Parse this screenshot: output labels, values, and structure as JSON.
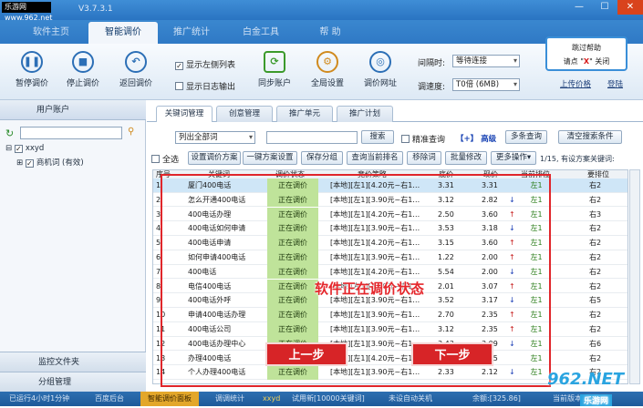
{
  "window": {
    "watermark": "乐游网 www.962.net",
    "title": "V3.7.3.1",
    "close_glyph": "✕",
    "min_glyph": "—",
    "max_glyph": "☐"
  },
  "main_tabs": [
    "软件主页",
    "智能调价",
    "推广统计",
    "白金工具",
    "帮 助"
  ],
  "toolbar": {
    "buttons": [
      {
        "label": "暂停调价",
        "icon": "pause-icon"
      },
      {
        "label": "停止调价",
        "icon": "stop-icon"
      },
      {
        "label": "返回调价",
        "icon": "return-icon"
      },
      {
        "label": "同步账户",
        "icon": "sync-icon"
      },
      {
        "label": "全局设置",
        "icon": "settings-icon"
      },
      {
        "label": "调价网址",
        "icon": "globe-icon"
      }
    ],
    "checkbox_left_list": "显示左侧列表",
    "checkbox_log": "显示日志输出",
    "interval_label": "间隔时:",
    "interval_value": "等待连接",
    "speed_label": "调速度:",
    "speed_value": "T0倍 (6MB)",
    "upload_link": "上传价格",
    "account_link": "登陆",
    "help_line1": "跳过帮助",
    "help_line2_pre": "请点 \"",
    "help_line2_x": "X",
    "help_line2_post": "\" 关闭"
  },
  "left": {
    "header": "用户账户",
    "tree_root": "xxyd",
    "tree_child": "商机词 (有效)",
    "footer1": "监控文件夹",
    "footer2": "分组管理"
  },
  "subtabs": [
    "关键词管理",
    "创意管理",
    "推广单元",
    "推广计划"
  ],
  "filter": {
    "scope": "列出全部词",
    "search_btn": "搜索",
    "exact_label": "精准查询",
    "advanced": "【+】 高级",
    "multi_search": "多条查询",
    "clear": "清空搜索条件"
  },
  "actions": [
    "全选",
    "设置调价方案",
    "一键方案设置",
    "保存分组",
    "查询当前排名",
    "移除词",
    "批量修改",
    "更多操作▾"
  ],
  "page_info": "1/15, 有设方案关键词:",
  "table": {
    "headers": [
      "序号",
      "关键词",
      "调价状态",
      "竞价策略",
      "底价",
      "现价",
      "当前排位",
      "要排位"
    ],
    "rows": [
      {
        "no": "1",
        "kw": "厦门400电话",
        "status": "正在调价",
        "strategy": "[本地][左1][4.20元~右1…",
        "min": "3.31",
        "cur": "3.31",
        "dir": "",
        "pos": "左1",
        "target": "右2"
      },
      {
        "no": "2",
        "kw": "怎么开通400电话",
        "status": "正在调价",
        "strategy": "[本地][左1][3.90元~右1…",
        "min": "3.12",
        "cur": "2.82",
        "dir": "down",
        "pos": "左1",
        "target": "右2"
      },
      {
        "no": "3",
        "kw": "400电话办理",
        "status": "正在调价",
        "strategy": "[本地][左1][4.20元~右1…",
        "min": "2.50",
        "cur": "3.60",
        "dir": "up",
        "pos": "左1",
        "target": "右3"
      },
      {
        "no": "4",
        "kw": "400电话如何申请",
        "status": "正在调价",
        "strategy": "[本地][左1][3.90元~右1…",
        "min": "3.53",
        "cur": "3.18",
        "dir": "down",
        "pos": "左1",
        "target": "右2"
      },
      {
        "no": "5",
        "kw": "400电话申请",
        "status": "正在调价",
        "strategy": "[本地][左1][4.20元~右1…",
        "min": "3.15",
        "cur": "3.60",
        "dir": "up",
        "pos": "左1",
        "target": "右2"
      },
      {
        "no": "6",
        "kw": "如何申请400电话",
        "status": "正在调价",
        "strategy": "[本地][左1][3.90元~右1…",
        "min": "1.22",
        "cur": "2.00",
        "dir": "up",
        "pos": "左1",
        "target": "右2"
      },
      {
        "no": "7",
        "kw": "400电话",
        "status": "正在调价",
        "strategy": "[本地][左1][4.20元~右1…",
        "min": "5.54",
        "cur": "2.00",
        "dir": "down",
        "pos": "左1",
        "target": "右2"
      },
      {
        "no": "8",
        "kw": "电信400电话",
        "status": "正在调价",
        "strategy": "[本地][左1][3.90元~右1…",
        "min": "2.01",
        "cur": "3.07",
        "dir": "up",
        "pos": "左1",
        "target": "右2"
      },
      {
        "no": "9",
        "kw": "400电话外呼",
        "status": "正在调价",
        "strategy": "[本地][左1][3.90元~右1…",
        "min": "3.52",
        "cur": "3.17",
        "dir": "down",
        "pos": "左1",
        "target": "右5"
      },
      {
        "no": "10",
        "kw": "申请400电话办理",
        "status": "正在调价",
        "strategy": "[本地][左1][3.90元~右1…",
        "min": "2.70",
        "cur": "2.35",
        "dir": "up",
        "pos": "左1",
        "target": "右2"
      },
      {
        "no": "11",
        "kw": "400电话公司",
        "status": "正在调价",
        "strategy": "[本地][左1][3.90元~右1…",
        "min": "3.12",
        "cur": "2.35",
        "dir": "up",
        "pos": "左1",
        "target": "右2"
      },
      {
        "no": "12",
        "kw": "400电话办理中心",
        "status": "正在调价",
        "strategy": "[本地][左1][3.90元~右1…",
        "min": "3.43",
        "cur": "3.09",
        "dir": "down",
        "pos": "左1",
        "target": "右6"
      },
      {
        "no": "13",
        "kw": "办理400电话",
        "status": "正在调价",
        "strategy": "[本地][左1][4.20元~右1…",
        "min": "3.75",
        "cur": "3.75",
        "dir": "",
        "pos": "左1",
        "target": "右2"
      },
      {
        "no": "14",
        "kw": "个人办理400电话",
        "status": "正在调价",
        "strategy": "[本地][左1][3.90元~右1…",
        "min": "2.33",
        "cur": "2.12",
        "dir": "down",
        "pos": "左1",
        "target": "右2"
      }
    ]
  },
  "overlay": {
    "caption": "软件正在调价状态",
    "prev": "上一步",
    "next": "下一步"
  },
  "statusbar": {
    "runtime": "已运行4小时1分钟",
    "baidu": "百度后台",
    "panel": "智能调价面板",
    "stats": "调调统计",
    "user": "xxyd",
    "trial": "试用新[10000关键词]",
    "device": "未设自动关机",
    "balance": "余额:[325.86]",
    "ver": "当前版本:"
  },
  "brand_logo": "962.NET",
  "brand_sub": "乐游网"
}
